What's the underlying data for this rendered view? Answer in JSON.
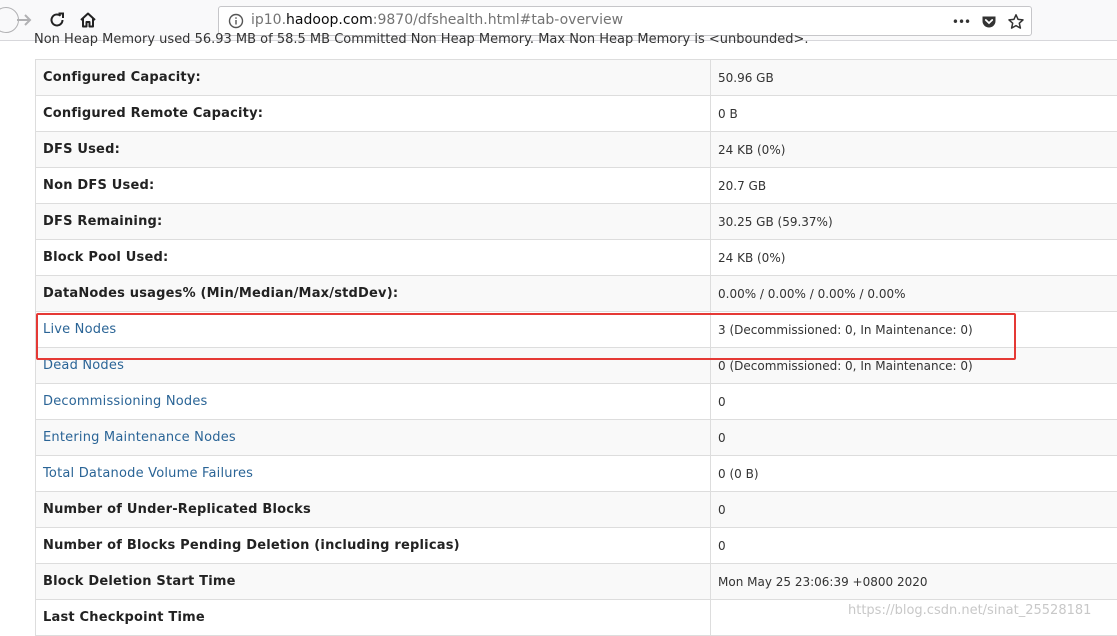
{
  "browser": {
    "url_prefix": "ip10.",
    "url_domain": "hadoop.com",
    "url_suffix": ":9870/dfshealth.html#tab-overview",
    "more_label": "•••"
  },
  "page": {
    "cutoff_text": "Non Heap Memory used 56.93 MB of 58.5 MB Committed Non Heap Memory. Max Non Heap Memory is <unbounded>.",
    "watermark": "https://blog.csdn.net/sinat_25528181"
  },
  "rows": [
    {
      "key": "Configured Capacity:",
      "value": "50.96 GB"
    },
    {
      "key": "Configured Remote Capacity:",
      "value": "0 B"
    },
    {
      "key": "DFS Used:",
      "value": "24 KB (0%)"
    },
    {
      "key": "Non DFS Used:",
      "value": "20.7 GB"
    },
    {
      "key": "DFS Remaining:",
      "value": "30.25 GB (59.37%)"
    },
    {
      "key": "Block Pool Used:",
      "value": "24 KB (0%)"
    },
    {
      "key": "DataNodes usages% (Min/Median/Max/stdDev):",
      "value": "0.00% / 0.00% / 0.00% / 0.00%"
    },
    {
      "key": "Live Nodes",
      "value": "3 (Decommissioned: 0, In Maintenance: 0)"
    },
    {
      "key": "Dead Nodes",
      "value": "0 (Decommissioned: 0, In Maintenance: 0)"
    },
    {
      "key": "Decommissioning Nodes",
      "value": "0"
    },
    {
      "key": "Entering Maintenance Nodes",
      "value": "0"
    },
    {
      "key": "Total Datanode Volume Failures",
      "value": "0 (0 B)"
    },
    {
      "key": "Number of Under-Replicated Blocks",
      "value": "0"
    },
    {
      "key": "Number of Blocks Pending Deletion (including replicas)",
      "value": "0"
    },
    {
      "key": "Block Deletion Start Time",
      "value": "Mon May 25 23:06:39 +0800 2020"
    },
    {
      "key": "Last Checkpoint Time",
      "value": ""
    }
  ]
}
